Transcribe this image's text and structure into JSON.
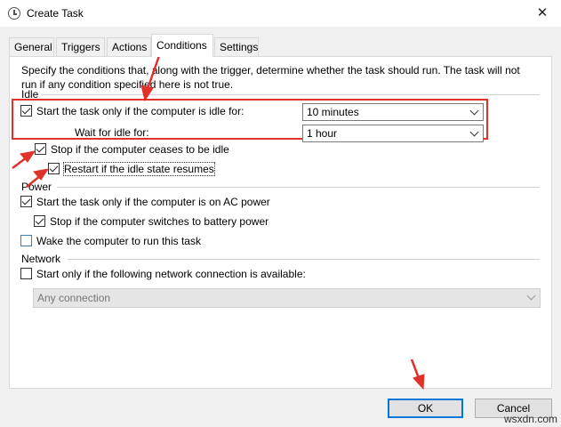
{
  "window": {
    "title": "Create Task",
    "close_glyph": "✕"
  },
  "tabs": [
    {
      "label": "General"
    },
    {
      "label": "Triggers"
    },
    {
      "label": "Actions"
    },
    {
      "label": "Conditions",
      "active": true
    },
    {
      "label": "Settings"
    }
  ],
  "intro": {
    "line1": "Specify the conditions that, along with the trigger, determine whether the task should run.  The task will not",
    "line2": "run  if any condition specified here is not true."
  },
  "idle": {
    "section_label": "Idle",
    "start_if_idle": {
      "label": "Start the task only if the computer is idle for:",
      "checked": true
    },
    "idle_for": {
      "value": "10 minutes"
    },
    "wait_label": "Wait for idle for:",
    "wait_for": {
      "value": "1 hour"
    },
    "stop_if_ceases": {
      "label": "Stop if the computer ceases to be idle",
      "checked": true
    },
    "restart_if_resumes": {
      "label": "Restart if the idle state resumes",
      "checked": true
    }
  },
  "power": {
    "section_label": "Power",
    "ac_power": {
      "label": "Start the task only if the computer is on AC power",
      "checked": true
    },
    "battery_stop": {
      "label": "Stop if the computer switches to battery power",
      "checked": true
    },
    "wake": {
      "label": "Wake the computer to run this task",
      "checked": false
    }
  },
  "network": {
    "section_label": "Network",
    "start_only_if": {
      "label": "Start only if the following network connection is available:",
      "checked": false
    },
    "connection": {
      "value": "Any connection",
      "disabled": true
    }
  },
  "buttons": {
    "ok": "OK",
    "cancel": "Cancel"
  },
  "watermark": "wsxdn.com",
  "colors": {
    "annotation_red": "#e0322a",
    "default_button_border": "#0078d7"
  }
}
